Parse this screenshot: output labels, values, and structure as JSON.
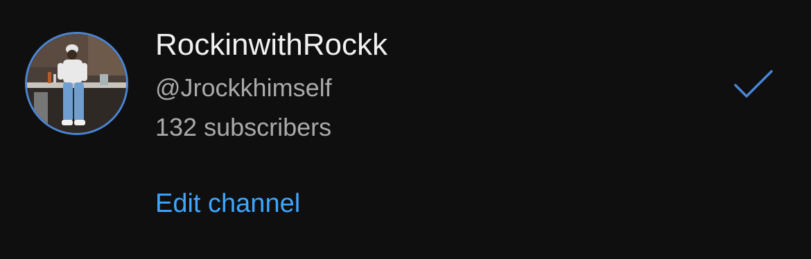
{
  "account": {
    "name": "RockinwithRockk",
    "handle": "@Jrockkhimself",
    "subscribers": "132 subscribers",
    "edit_label": "Edit channel",
    "selected": true
  },
  "icons": {
    "selected": "checkmark-icon",
    "avatar": "profile-photo"
  },
  "colors": {
    "background": "#0f0f0f",
    "primary_text": "#f1f1f1",
    "secondary_text": "#aaaaaa",
    "link": "#3ea6ff",
    "accent": "#4a86d6"
  }
}
